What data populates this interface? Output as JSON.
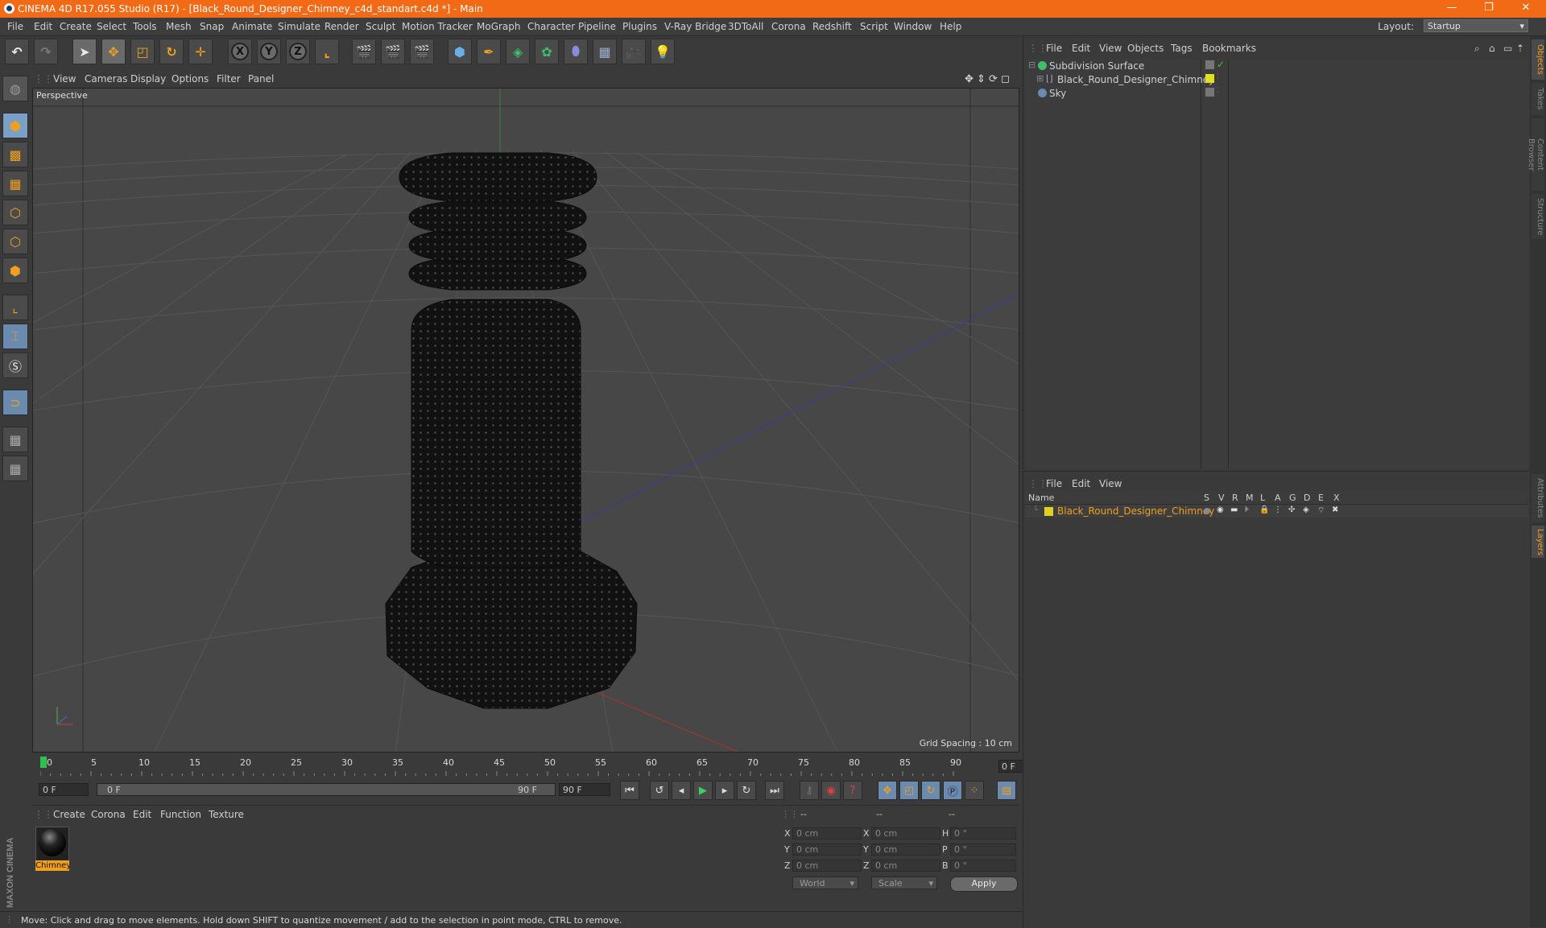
{
  "window": {
    "title": "CINEMA 4D R17.055 Studio (R17) - [Black_Round_Designer_Chimney_c4d_standart.c4d *] - Main",
    "minimize": "—",
    "maximize": "❐",
    "close": "✕"
  },
  "menubar": {
    "items": [
      "File",
      "Edit",
      "Create",
      "Select",
      "Tools",
      "Mesh",
      "Snap",
      "Animate",
      "Simulate",
      "Render",
      "Sculpt",
      "Motion Tracker",
      "MoGraph",
      "Character",
      "Pipeline",
      "Plugins",
      "V-Ray Bridge",
      "3DToAll",
      "Corona",
      "Redshift",
      "Script",
      "Window",
      "Help"
    ],
    "layout_label": "Layout:",
    "layout_value": "Startup"
  },
  "toolbar": {
    "axis_x": "X",
    "axis_y": "Y",
    "axis_z": "Z"
  },
  "viewport": {
    "menu": [
      "View",
      "Cameras",
      "Display",
      "Options",
      "Filter",
      "Panel"
    ],
    "label": "Perspective",
    "grid_spacing": "Grid Spacing : 10 cm"
  },
  "timeline": {
    "ticks": [
      "0",
      "5",
      "10",
      "15",
      "20",
      "25",
      "30",
      "35",
      "40",
      "45",
      "50",
      "55",
      "60",
      "65",
      "70",
      "75",
      "80",
      "85",
      "90"
    ],
    "current_frame": "0 F",
    "start_field": "0 F",
    "range_start": "0 F",
    "range_end": "90 F",
    "end_field": "90 F"
  },
  "material_manager": {
    "menu": [
      "Create",
      "Corona",
      "Edit",
      "Function",
      "Texture"
    ],
    "material_name": "Chimney"
  },
  "coordinates": {
    "header": [
      "--",
      "--",
      "--"
    ],
    "rows": [
      {
        "l1": "X",
        "v1": "0 cm",
        "l2": "X",
        "v2": "0 cm",
        "l3": "H",
        "v3": "0 °"
      },
      {
        "l1": "Y",
        "v1": "0 cm",
        "l2": "Y",
        "v2": "0 cm",
        "l3": "P",
        "v3": "0 °"
      },
      {
        "l1": "Z",
        "v1": "0 cm",
        "l2": "Z",
        "v2": "0 cm",
        "l3": "B",
        "v3": "0 °"
      }
    ],
    "mode": "World",
    "transform": "Scale",
    "apply": "Apply"
  },
  "status": "Move: Click and drag to move elements. Hold down SHIFT to quantize movement / add to the selection in point mode, CTRL to remove.",
  "object_manager": {
    "menu": [
      "File",
      "Edit",
      "View",
      "Objects",
      "Tags",
      "Bookmarks"
    ],
    "objects": [
      {
        "name": "Subdivision Surface",
        "color": "#3fbf6a"
      },
      {
        "name": "Black_Round_Designer_Chimney",
        "color": "#e0e020"
      },
      {
        "name": "Sky",
        "color": "#6a8ab0"
      }
    ]
  },
  "layer_manager": {
    "menu": [
      "File",
      "Edit",
      "View"
    ],
    "columns": [
      "Name",
      "S",
      "V",
      "R",
      "M",
      "L",
      "A",
      "G",
      "D",
      "E",
      "X"
    ],
    "layer_name": "Black_Round_Designer_Chimney",
    "layer_color": "#e0d020"
  },
  "side_tabs": [
    "Objects",
    "Takes",
    "Content Browser",
    "Structure",
    "Attributes",
    "Layers"
  ],
  "brand": "MAXON CINEMA 4D"
}
